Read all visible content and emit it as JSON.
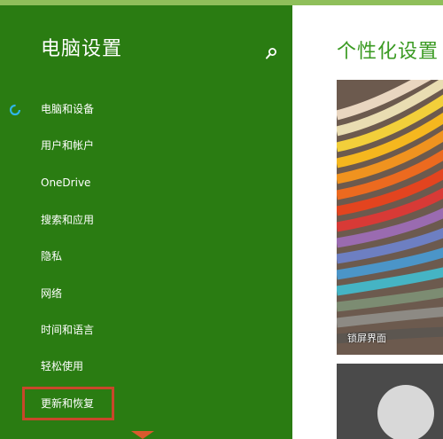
{
  "sidebar": {
    "title": "电脑设置",
    "search_icon": "search-icon",
    "items": [
      {
        "label": "电脑和设备"
      },
      {
        "label": "用户和帐户"
      },
      {
        "label": "OneDrive"
      },
      {
        "label": "搜索和应用"
      },
      {
        "label": "隐私"
      },
      {
        "label": "网络"
      },
      {
        "label": "时间和语言"
      },
      {
        "label": "轻松使用"
      },
      {
        "label": "更新和恢复"
      }
    ],
    "active_marker_icon": "loading-spinner-icon",
    "highlighted_item": "更新和恢复"
  },
  "content": {
    "title": "个性化设置",
    "tiles": [
      {
        "label": "锁屏界面"
      },
      {
        "label": ""
      }
    ]
  },
  "colors": {
    "sidebar_bg": "#2a7c12",
    "accent_title": "#3a9a22",
    "highlight_border": "#c8472a"
  }
}
